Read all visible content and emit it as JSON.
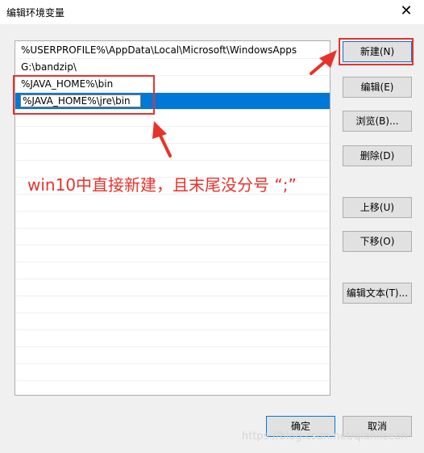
{
  "window": {
    "title": "编辑环境变量",
    "close_glyph": "✕"
  },
  "path_list": {
    "entries": [
      "%USERPROFILE%\\AppData\\Local\\Microsoft\\WindowsApps",
      "G:\\bandzip\\",
      "%JAVA_HOME%\\bin"
    ],
    "editing_value": "%JAVA_HOME%\\jre\\bin"
  },
  "buttons": {
    "new": "新建(N)",
    "edit": "编辑(E)",
    "browse": "浏览(B)...",
    "delete": "删除(D)",
    "move_up": "上移(U)",
    "move_down": "下移(O)",
    "edit_text": "编辑文本(T)...",
    "ok": "确定",
    "cancel": "取消"
  },
  "annotation": {
    "text": "win10中直接新建，且末尾没分号 “;”",
    "color": "#e8322a"
  },
  "watermark": "https://blog.csdn.net/qianlicean",
  "colors": {
    "selection": "#0078d7",
    "dialog_bg": "#f0f0f0"
  }
}
